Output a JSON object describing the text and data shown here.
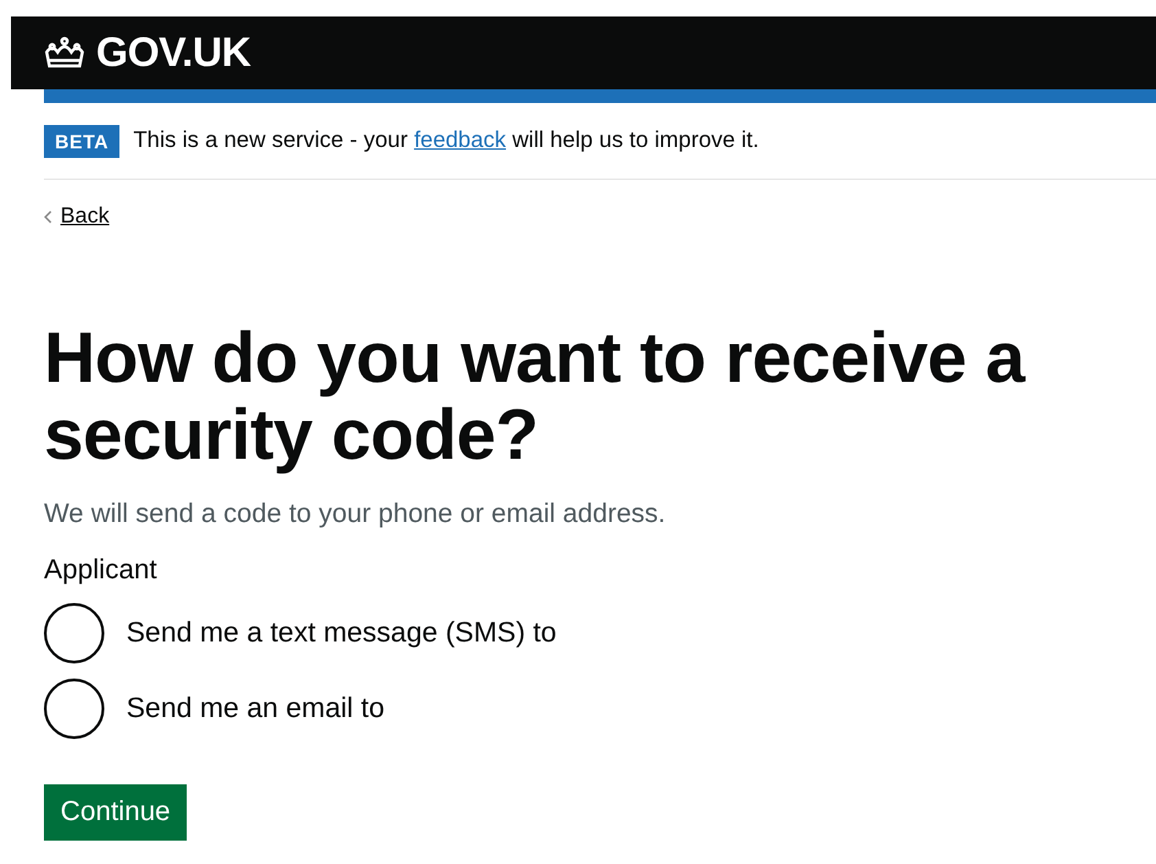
{
  "header": {
    "logo_text": "GOV.UK"
  },
  "phase_banner": {
    "tag": "BETA",
    "text_before": "This is a new service - your",
    "link": "feedback",
    "text_after": "will help us to improve it."
  },
  "back_link": "Back",
  "heading": "How do you want to receive a security code?",
  "hint": "We will send a code to your phone or email address.",
  "legend": "Applicant",
  "options": [
    {
      "label": "Send me a text message (SMS) to",
      "selected": false
    },
    {
      "label": "Send me an email to",
      "selected": false
    }
  ],
  "button": "Continue"
}
